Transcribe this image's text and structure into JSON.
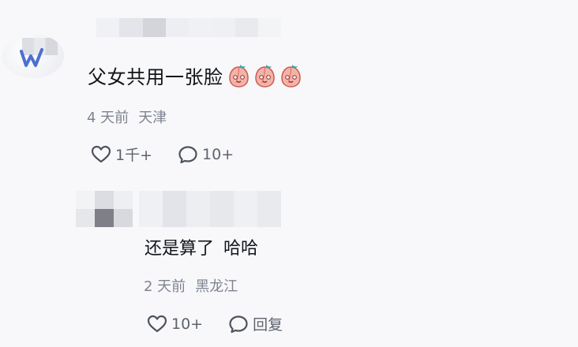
{
  "comments": [
    {
      "text": "父女共用一张脸",
      "emoji": [
        "peach-face-emoji",
        "peach-face-emoji",
        "peach-face-emoji"
      ],
      "time": "4 天前",
      "location": "天津",
      "likes": "1千+",
      "replies": "10+"
    },
    {
      "text": "还是算了",
      "text_suffix": "哈哈",
      "time": "2 天前",
      "location": "黑龙江",
      "likes": "10+",
      "reply_label": "回复"
    }
  ],
  "icons": {
    "like": "heart-outline-icon",
    "comment": "speech-bubble-icon"
  },
  "colors": {
    "text": "#111418",
    "meta": "#7d8390",
    "action": "#5d636e",
    "background": "#f8f8fa",
    "avatar_mark": "#4c6fd3"
  }
}
